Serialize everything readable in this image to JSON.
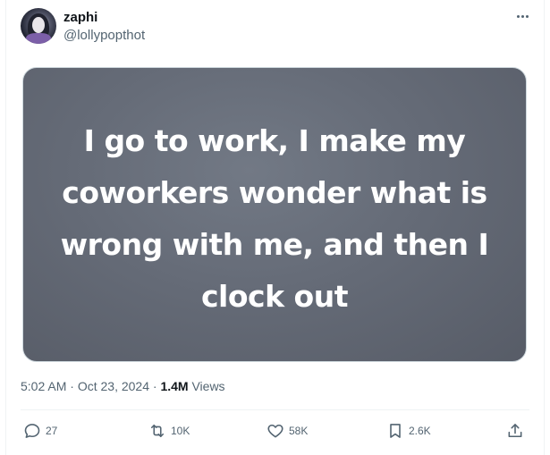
{
  "author": {
    "display_name": "zaphi",
    "handle": "@lollypopthot"
  },
  "media": {
    "text": "I go to work, I make my coworkers wonder what is wrong with me, and then I clock out"
  },
  "meta": {
    "time": "5:02 AM",
    "separator_1": "·",
    "date": "Oct 23, 2024",
    "separator_2": "·",
    "views_count": "1.4M",
    "views_label": "Views"
  },
  "actions": {
    "replies": "27",
    "reposts": "10K",
    "likes": "58K",
    "bookmarks": "2.6K"
  },
  "icons": {
    "more": "more-horizontal-icon",
    "reply": "reply-icon",
    "repost": "repost-icon",
    "like": "heart-icon",
    "bookmark": "bookmark-icon",
    "share": "share-icon"
  },
  "colors": {
    "text_primary": "#0f1419",
    "text_secondary": "#536471",
    "media_background": "#656b77",
    "divider": "#eff3f4"
  }
}
